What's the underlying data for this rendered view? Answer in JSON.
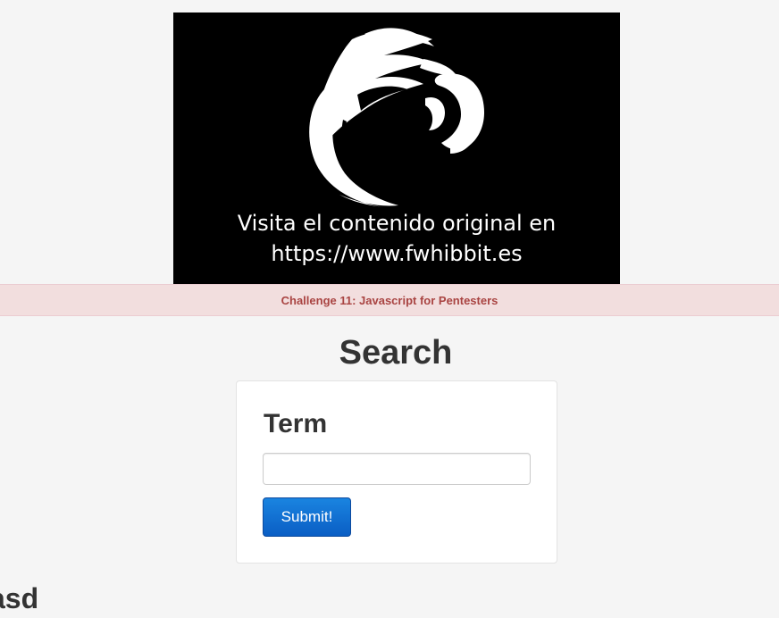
{
  "banner": {
    "line1": "Visita el contenido original en",
    "line2": "https://www.fwhibbit.es"
  },
  "alert": {
    "text": "Challenge 11: Javascript for Pentesters",
    "color": "#a94442",
    "background": "#f2dede"
  },
  "page": {
    "title": "Search"
  },
  "form": {
    "label": "Term",
    "input_value": "",
    "submit_label": "Submit!"
  },
  "footer": {
    "heading": "asd"
  }
}
